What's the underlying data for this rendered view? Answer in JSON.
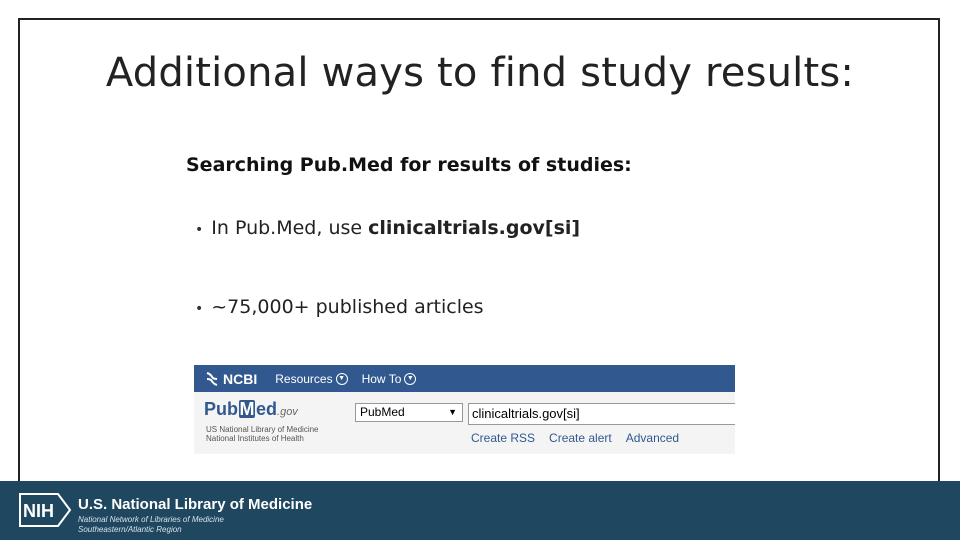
{
  "slide": {
    "title": "Additional ways to find study results:",
    "subtitle": "Searching Pub.Med for results of studies:",
    "bullets": [
      {
        "text_before": "In Pub.Med, use ",
        "bold": "clinicaltrials.gov[si]"
      },
      {
        "text_before": "~75,000+ published articles",
        "bold": ""
      }
    ]
  },
  "pubmed": {
    "ncbi_label": "NCBI",
    "menu": [
      "Resources",
      "How To"
    ],
    "logo_pub": "Pub",
    "logo_m": "M",
    "logo_ed": "ed",
    "logo_gov": ".gov",
    "nlm_line1": "US National Library of Medicine",
    "nlm_line2": "National Institutes of Health",
    "db_selected": "PubMed",
    "search_value": "clinicaltrials.gov[si]",
    "links": [
      "Create RSS",
      "Create alert",
      "Advanced"
    ]
  },
  "footer": {
    "nih": "NIH",
    "org_name": "U.S. National Library of Medicine",
    "network_line1": "National Network of Libraries of Medicine",
    "network_line2": "Southeastern/Atlantic Region"
  },
  "colors": {
    "ncbi_blue": "#31598f",
    "footer_navy": "#1f4760"
  }
}
